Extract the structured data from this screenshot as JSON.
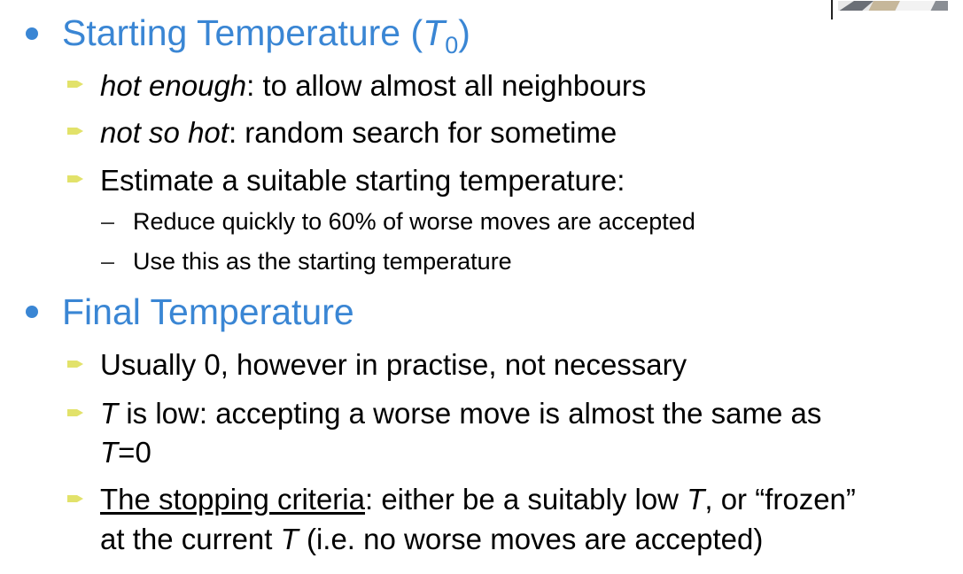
{
  "sections": [
    {
      "heading_prefix": "Starting Temperature (",
      "heading_var": "T",
      "heading_sub": "0",
      "heading_suffix": ")",
      "items": [
        {
          "em": "hot enough",
          "text": ": to allow almost all neighbours"
        },
        {
          "em": "not so hot",
          "text": ": random search for sometime"
        },
        {
          "text": "Estimate a suitable starting temperature:"
        }
      ],
      "subitems": [
        "Reduce quickly to 60% of worse moves are accepted",
        "Use this as the starting temperature"
      ]
    },
    {
      "heading": "Final Temperature",
      "items": [
        {
          "text": "Usually 0, however in practise, not necessary"
        },
        {
          "line1_var": "T",
          "line1_text": " is low: accepting a worse move is almost the same as",
          "line2_var": "T",
          "line2_text": "=0"
        },
        {
          "underlined": "The stopping criteria",
          "line1_a": ": either be a suitably low ",
          "line1_var": "T",
          "line1_b": ", or “frozen”",
          "line2_a": "at the current ",
          "line2_var": "T",
          "line2_b": " (i.e. no worse moves are accepted)"
        }
      ]
    }
  ],
  "colors": {
    "heading": "#3a86d4",
    "bullet_arrow": "#e2e26a",
    "bullet_dot": "#3a86d4"
  },
  "icons": {
    "heading_bullet": "round-dot-icon",
    "item_bullet": "arrow-bullet-icon",
    "sub_bullet": "dash-icon"
  }
}
